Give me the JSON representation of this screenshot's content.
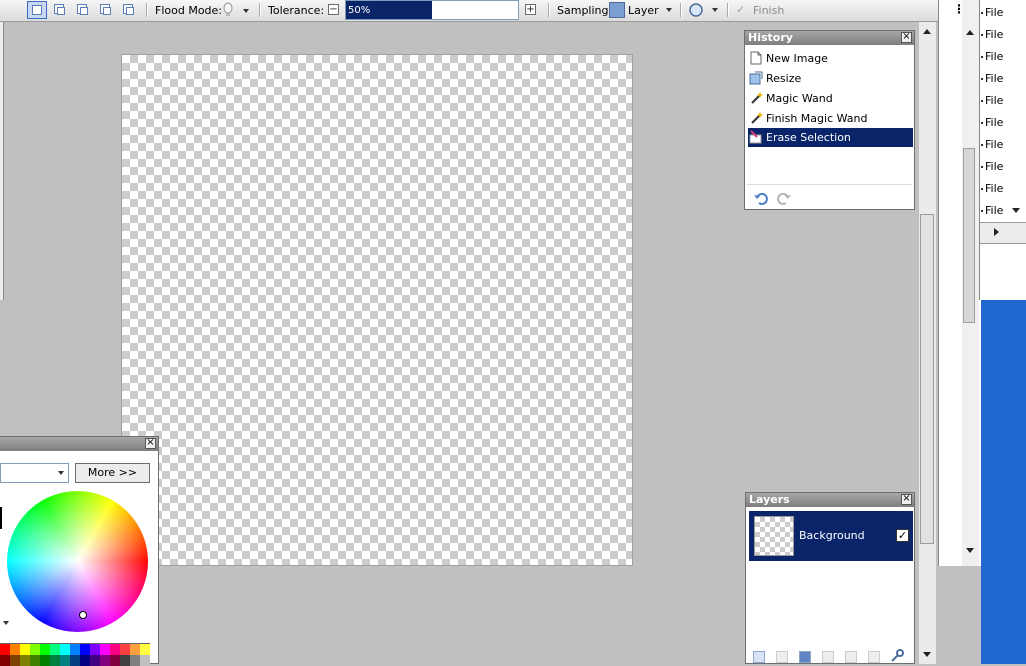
{
  "toolbar": {
    "flood_mode_label": "Flood Mode:",
    "tolerance_label": "Tolerance:",
    "tolerance_value": "50%",
    "tolerance_fraction": 0.5,
    "sampling_label": "Sampling:",
    "sampling_value": "Layer",
    "finish_label": "Finish"
  },
  "history": {
    "title": "History",
    "items": [
      {
        "label": "New Image",
        "icon": "new-image-icon"
      },
      {
        "label": "Resize",
        "icon": "resize-icon"
      },
      {
        "label": "Magic Wand",
        "icon": "magic-wand-icon"
      },
      {
        "label": "Finish Magic Wand",
        "icon": "magic-wand-icon"
      },
      {
        "label": "Erase Selection",
        "icon": "erase-selection-icon"
      }
    ],
    "selected_index": 4
  },
  "layers": {
    "title": "Layers",
    "items": [
      {
        "name": "Background",
        "visible": true
      }
    ]
  },
  "colors": {
    "more_label": "More >>"
  },
  "file_list": {
    "items": [
      "File",
      "File",
      "File",
      "File",
      "File",
      "File",
      "File",
      "File",
      "File",
      "File"
    ]
  },
  "accent": {
    "selection": "#0a246a",
    "desktop": "#2167d0",
    "workspace": "#c0c0c0"
  }
}
